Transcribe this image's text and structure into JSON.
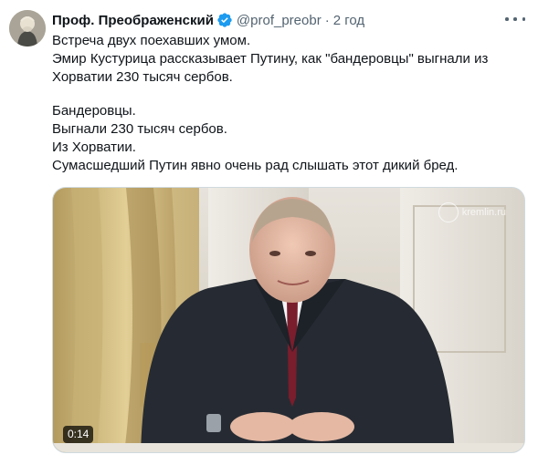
{
  "author": {
    "display_name": "Проф. Преображенский",
    "handle": "@prof_preobr",
    "separator": "·",
    "timestamp": "2 год",
    "verified": true
  },
  "tweet": {
    "paragraph_1": [
      "Встреча двух поехавших умом.",
      "Эмир Кустурица рассказывает Путину, как \"бандеровцы\" выгнали из",
      "Хорватии 230 тысяч сербов."
    ],
    "paragraph_2": [
      "Бандеровцы.",
      "Выгнали 230 тысяч сербов.",
      "Из Хорватии.",
      "Сумасшедший Путин явно очень рад слышать этот дикий бред."
    ]
  },
  "media": {
    "type": "video",
    "duration": "0:14",
    "watermark": "kremlin.ru"
  },
  "colors": {
    "text": "#0f1419",
    "secondary": "#536471",
    "verified": "#1d9bf0",
    "border": "#cfd9de"
  },
  "icons": {
    "verified": "verified-badge-icon",
    "more": "more-options-icon",
    "watermark": "eagle-emblem-icon"
  }
}
